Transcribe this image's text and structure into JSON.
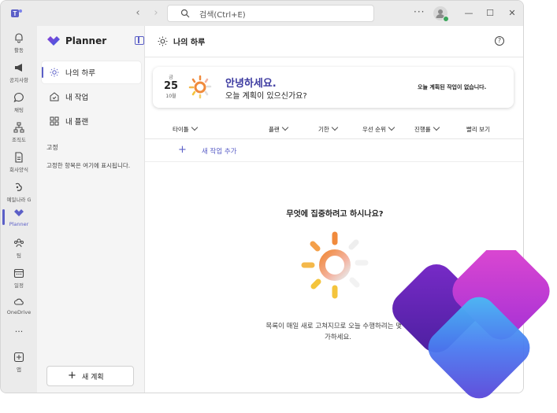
{
  "titlebar": {
    "search_placeholder": "검색(Ctrl+E)",
    "more_label": "···"
  },
  "rail": {
    "items": [
      {
        "label": "활동",
        "icon": "bell-icon"
      },
      {
        "label": "공지사항",
        "icon": "megaphone-icon"
      },
      {
        "label": "채팅",
        "icon": "chat-icon"
      },
      {
        "label": "조직도",
        "icon": "org-chart-icon"
      },
      {
        "label": "회사양식",
        "icon": "document-icon"
      },
      {
        "label": "예일나라 G",
        "icon": "app-icon"
      },
      {
        "label": "Planner",
        "icon": "planner-icon",
        "active": true
      },
      {
        "label": "팀",
        "icon": "teams-icon"
      },
      {
        "label": "일정",
        "icon": "calendar-icon"
      },
      {
        "label": "OneDrive",
        "icon": "cloud-icon"
      },
      {
        "label": "앱",
        "icon": "add-app-icon"
      }
    ],
    "more_label": "···"
  },
  "leftpane": {
    "title": "Planner",
    "items": [
      {
        "label": "나의 하루",
        "icon": "sun-icon",
        "active": true
      },
      {
        "label": "내 작업",
        "icon": "tasks-icon"
      },
      {
        "label": "내 플랜",
        "icon": "grid-icon"
      }
    ],
    "pinned_section": "고정",
    "pinned_empty": "고정한 항목은 여기에 표시됩니다.",
    "new_plan_plus": "+",
    "new_plan_label": "새 계획"
  },
  "main": {
    "title": "나의 하루",
    "help_label": "?",
    "greeting": {
      "day": "금",
      "date": "25",
      "month": "10월",
      "hello": "안녕하세요.",
      "sub": "오늘 계획이 있으신가요?",
      "status": "오늘 계획된 작업이 없습니다."
    },
    "columns": [
      "타이틀",
      "플랜",
      "기한",
      "우선 순위",
      "진행률",
      "빨리 보기"
    ],
    "add_task_plus": "+",
    "add_task_label": "새 작업 추가",
    "empty_title": "무엇에 집중하려고 하시나요?",
    "empty_desc_line1": "목록이 매일 새로 고쳐지므로 오늘 수행하려는 몇 가",
    "empty_desc_line2": "가하세요."
  },
  "colors": {
    "accent": "#5b5fc7",
    "greeting_title": "#3d3ba0"
  }
}
